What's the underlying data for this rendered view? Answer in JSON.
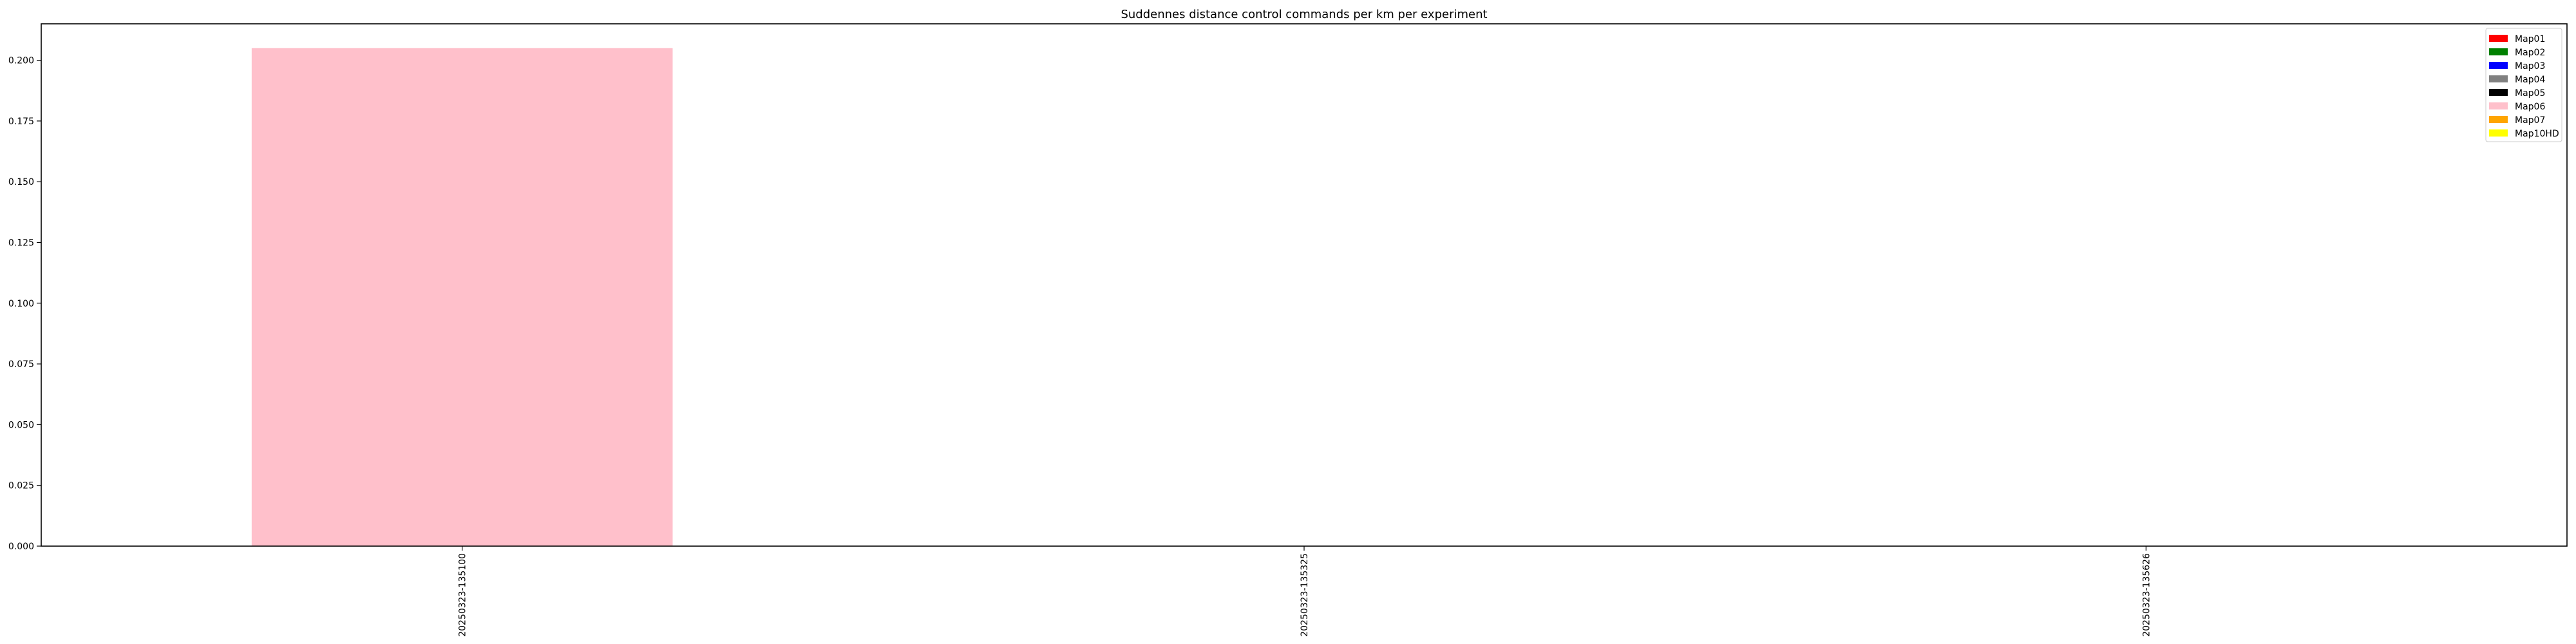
{
  "chart_data": {
    "type": "bar",
    "title": "Suddennes distance control commands per km per experiment",
    "xlabel": "",
    "ylabel": "",
    "categories": [
      "20250323-135100",
      "20250323-135325",
      "20250323-135626"
    ],
    "series": [
      {
        "name": "Map01",
        "color": "#ff0000",
        "values": [
          0,
          0,
          0
        ]
      },
      {
        "name": "Map02",
        "color": "#008000",
        "values": [
          0,
          0,
          0
        ]
      },
      {
        "name": "Map03",
        "color": "#0000ff",
        "values": [
          0,
          0,
          0
        ]
      },
      {
        "name": "Map04",
        "color": "#808080",
        "values": [
          0,
          0,
          0
        ]
      },
      {
        "name": "Map05",
        "color": "#000000",
        "values": [
          0,
          0,
          0
        ]
      },
      {
        "name": "Map06",
        "color": "#ffc0cb",
        "values": [
          0.205,
          0,
          0
        ]
      },
      {
        "name": "Map07",
        "color": "#ffa500",
        "values": [
          0,
          0,
          0
        ]
      },
      {
        "name": "Map10HD",
        "color": "#ffff00",
        "values": [
          0,
          0,
          0
        ]
      }
    ],
    "yticks": [
      "0.000",
      "0.025",
      "0.050",
      "0.075",
      "0.100",
      "0.125",
      "0.150",
      "0.175",
      "0.200"
    ],
    "ylim": [
      0,
      0.215
    ],
    "xlim": [
      -0.5,
      2.5
    ],
    "bar_width": 0.5,
    "grid": false,
    "legend_position": "top-right"
  }
}
